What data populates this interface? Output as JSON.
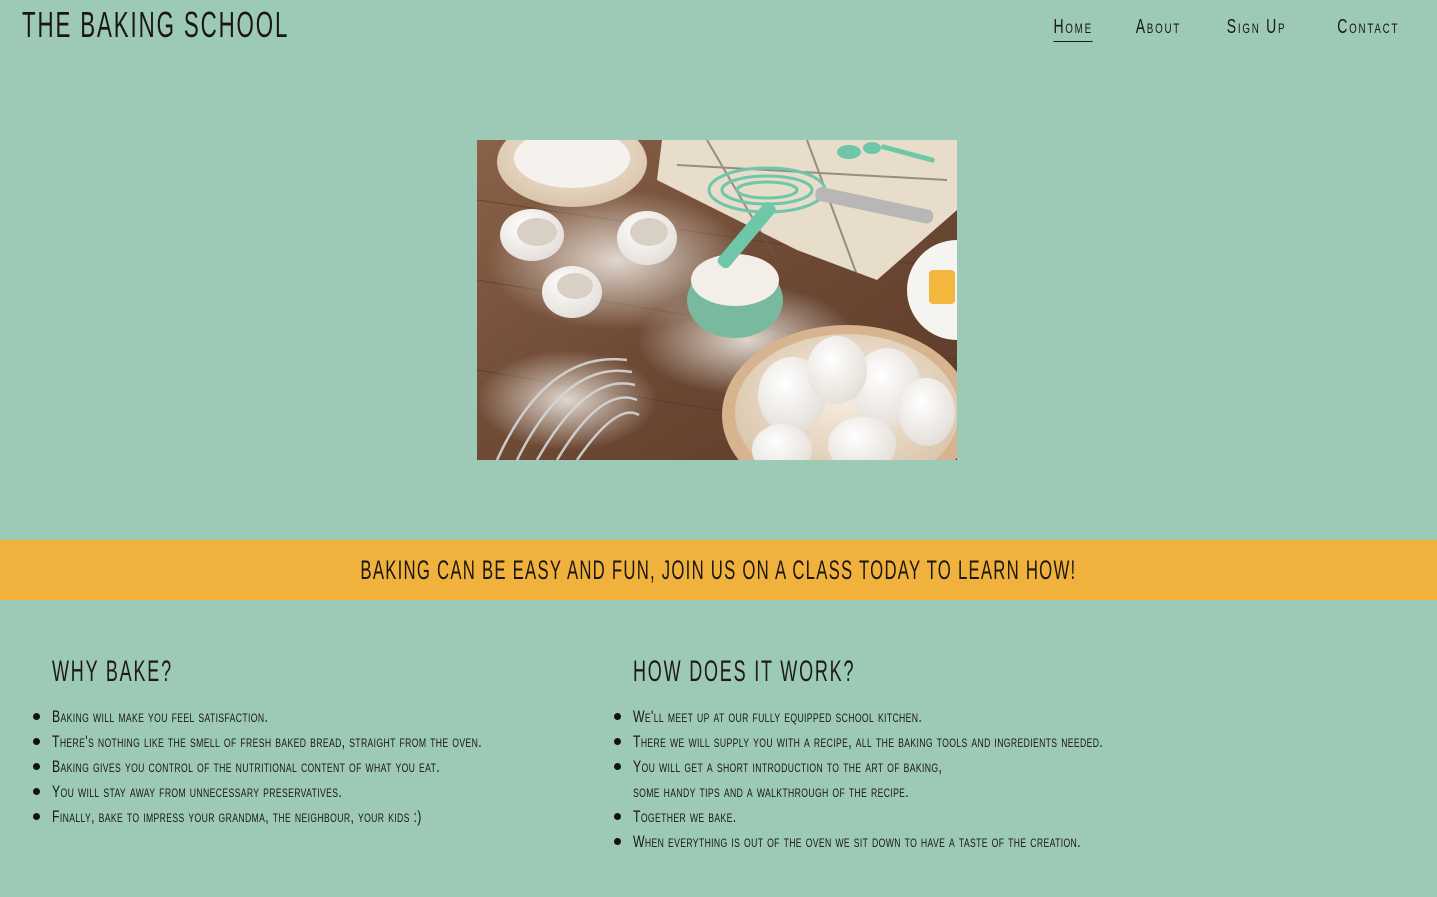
{
  "site": {
    "brand": "The Baking School"
  },
  "nav": {
    "items": [
      {
        "label": "Home"
      },
      {
        "label": "About"
      },
      {
        "label": "Sign Up"
      },
      {
        "label": "Contact"
      }
    ]
  },
  "hero": {
    "image_subject": "baking ingredients: eggs, flour, whisks, measuring cups"
  },
  "banner": {
    "text": "Baking can be easy and fun, join us on a class today to learn how!",
    "color": "#f0b23d"
  },
  "why": {
    "heading": "Why bake?",
    "items": [
      "Baking will make you feel satisfaction.",
      "There's nothing like the smell of fresh baked bread, straight from the oven.",
      "Baking gives you control of the nutritional content of what you eat.",
      "You will stay away from unnecessary preservatives.",
      "Finally, bake to impress your grandma, the neighbour, your kids :)"
    ]
  },
  "how": {
    "heading": "How does it work?",
    "items": [
      "We'll meet up at our fully equipped school kitchen.",
      "There we will supply you with a recipe, all the baking tools and ingredients needed.",
      "You will get a short introduction to the art of baking,",
      "Together we bake.",
      "When everything is out of the oven we sit down to have a taste of the creation."
    ],
    "item_3_continuation": "some handy tips and a walkthrough of the recipe."
  },
  "colors": {
    "background": "#9dcab7",
    "banner": "#f0b23d",
    "text": "#1a1712"
  }
}
